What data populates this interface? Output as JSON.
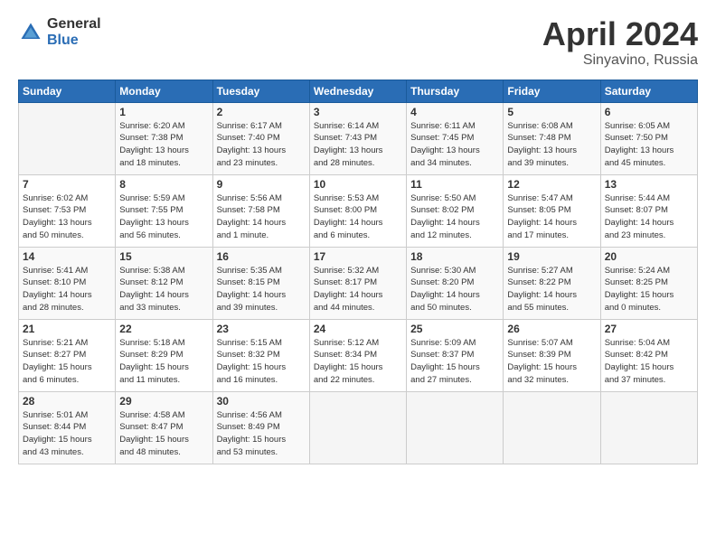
{
  "header": {
    "logo_general": "General",
    "logo_blue": "Blue",
    "title": "April 2024",
    "location": "Sinyavino, Russia"
  },
  "days_of_week": [
    "Sunday",
    "Monday",
    "Tuesday",
    "Wednesday",
    "Thursday",
    "Friday",
    "Saturday"
  ],
  "weeks": [
    [
      {
        "day": "",
        "info": ""
      },
      {
        "day": "1",
        "info": "Sunrise: 6:20 AM\nSunset: 7:38 PM\nDaylight: 13 hours\nand 18 minutes."
      },
      {
        "day": "2",
        "info": "Sunrise: 6:17 AM\nSunset: 7:40 PM\nDaylight: 13 hours\nand 23 minutes."
      },
      {
        "day": "3",
        "info": "Sunrise: 6:14 AM\nSunset: 7:43 PM\nDaylight: 13 hours\nand 28 minutes."
      },
      {
        "day": "4",
        "info": "Sunrise: 6:11 AM\nSunset: 7:45 PM\nDaylight: 13 hours\nand 34 minutes."
      },
      {
        "day": "5",
        "info": "Sunrise: 6:08 AM\nSunset: 7:48 PM\nDaylight: 13 hours\nand 39 minutes."
      },
      {
        "day": "6",
        "info": "Sunrise: 6:05 AM\nSunset: 7:50 PM\nDaylight: 13 hours\nand 45 minutes."
      }
    ],
    [
      {
        "day": "7",
        "info": "Sunrise: 6:02 AM\nSunset: 7:53 PM\nDaylight: 13 hours\nand 50 minutes."
      },
      {
        "day": "8",
        "info": "Sunrise: 5:59 AM\nSunset: 7:55 PM\nDaylight: 13 hours\nand 56 minutes."
      },
      {
        "day": "9",
        "info": "Sunrise: 5:56 AM\nSunset: 7:58 PM\nDaylight: 14 hours\nand 1 minute."
      },
      {
        "day": "10",
        "info": "Sunrise: 5:53 AM\nSunset: 8:00 PM\nDaylight: 14 hours\nand 6 minutes."
      },
      {
        "day": "11",
        "info": "Sunrise: 5:50 AM\nSunset: 8:02 PM\nDaylight: 14 hours\nand 12 minutes."
      },
      {
        "day": "12",
        "info": "Sunrise: 5:47 AM\nSunset: 8:05 PM\nDaylight: 14 hours\nand 17 minutes."
      },
      {
        "day": "13",
        "info": "Sunrise: 5:44 AM\nSunset: 8:07 PM\nDaylight: 14 hours\nand 23 minutes."
      }
    ],
    [
      {
        "day": "14",
        "info": "Sunrise: 5:41 AM\nSunset: 8:10 PM\nDaylight: 14 hours\nand 28 minutes."
      },
      {
        "day": "15",
        "info": "Sunrise: 5:38 AM\nSunset: 8:12 PM\nDaylight: 14 hours\nand 33 minutes."
      },
      {
        "day": "16",
        "info": "Sunrise: 5:35 AM\nSunset: 8:15 PM\nDaylight: 14 hours\nand 39 minutes."
      },
      {
        "day": "17",
        "info": "Sunrise: 5:32 AM\nSunset: 8:17 PM\nDaylight: 14 hours\nand 44 minutes."
      },
      {
        "day": "18",
        "info": "Sunrise: 5:30 AM\nSunset: 8:20 PM\nDaylight: 14 hours\nand 50 minutes."
      },
      {
        "day": "19",
        "info": "Sunrise: 5:27 AM\nSunset: 8:22 PM\nDaylight: 14 hours\nand 55 minutes."
      },
      {
        "day": "20",
        "info": "Sunrise: 5:24 AM\nSunset: 8:25 PM\nDaylight: 15 hours\nand 0 minutes."
      }
    ],
    [
      {
        "day": "21",
        "info": "Sunrise: 5:21 AM\nSunset: 8:27 PM\nDaylight: 15 hours\nand 6 minutes."
      },
      {
        "day": "22",
        "info": "Sunrise: 5:18 AM\nSunset: 8:29 PM\nDaylight: 15 hours\nand 11 minutes."
      },
      {
        "day": "23",
        "info": "Sunrise: 5:15 AM\nSunset: 8:32 PM\nDaylight: 15 hours\nand 16 minutes."
      },
      {
        "day": "24",
        "info": "Sunrise: 5:12 AM\nSunset: 8:34 PM\nDaylight: 15 hours\nand 22 minutes."
      },
      {
        "day": "25",
        "info": "Sunrise: 5:09 AM\nSunset: 8:37 PM\nDaylight: 15 hours\nand 27 minutes."
      },
      {
        "day": "26",
        "info": "Sunrise: 5:07 AM\nSunset: 8:39 PM\nDaylight: 15 hours\nand 32 minutes."
      },
      {
        "day": "27",
        "info": "Sunrise: 5:04 AM\nSunset: 8:42 PM\nDaylight: 15 hours\nand 37 minutes."
      }
    ],
    [
      {
        "day": "28",
        "info": "Sunrise: 5:01 AM\nSunset: 8:44 PM\nDaylight: 15 hours\nand 43 minutes."
      },
      {
        "day": "29",
        "info": "Sunrise: 4:58 AM\nSunset: 8:47 PM\nDaylight: 15 hours\nand 48 minutes."
      },
      {
        "day": "30",
        "info": "Sunrise: 4:56 AM\nSunset: 8:49 PM\nDaylight: 15 hours\nand 53 minutes."
      },
      {
        "day": "",
        "info": ""
      },
      {
        "day": "",
        "info": ""
      },
      {
        "day": "",
        "info": ""
      },
      {
        "day": "",
        "info": ""
      }
    ]
  ]
}
